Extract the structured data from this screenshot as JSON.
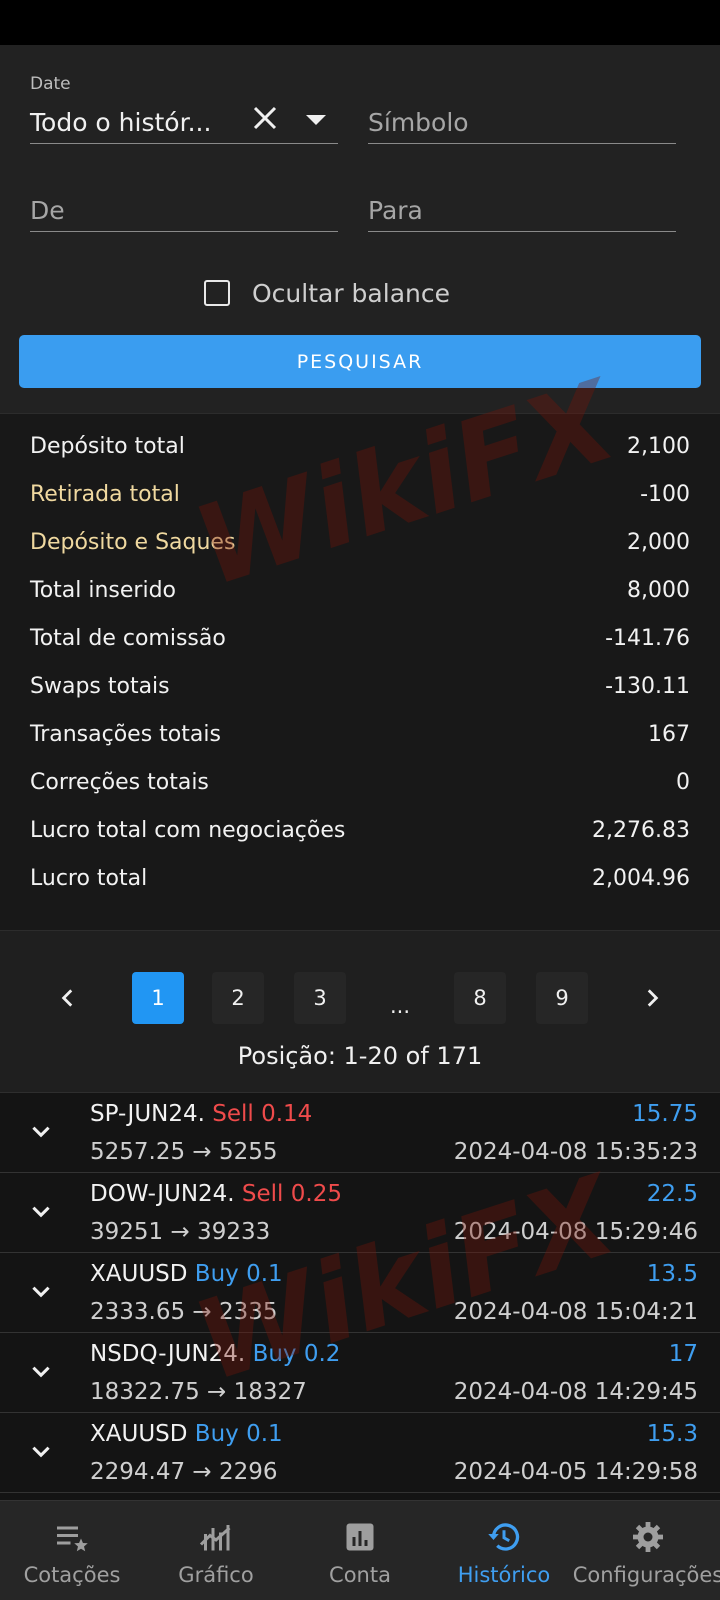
{
  "filters": {
    "date_label": "Date",
    "date_value": "Todo o histór...",
    "symbol_placeholder": "Símbolo",
    "from_placeholder": "De",
    "to_placeholder": "Para",
    "hide_balance_label": "Ocultar balance",
    "hide_balance_checked": false,
    "search_button": "PESQUISAR"
  },
  "summary": [
    {
      "label": "Depósito total",
      "value": "2,100"
    },
    {
      "label": "Retirada total",
      "value": "-100"
    },
    {
      "label": "Depósito e Saques",
      "value": "2,000"
    },
    {
      "label": "Total inserido",
      "value": "8,000"
    },
    {
      "label": "Total de comissão",
      "value": "-141.76"
    },
    {
      "label": "Swaps totais",
      "value": "-130.11"
    },
    {
      "label": "Transações totais",
      "value": "167"
    },
    {
      "label": "Correções totais",
      "value": "0"
    },
    {
      "label": "Lucro total com negociações",
      "value": "2,276.83"
    },
    {
      "label": "Lucro total",
      "value": "2,004.96"
    }
  ],
  "pagination": {
    "prev": "‹",
    "pages": [
      "1",
      "2",
      "3",
      "...",
      "8",
      "9"
    ],
    "active_page": "1",
    "next": "›",
    "position_text": "Posição: 1-20 of 171"
  },
  "deals": [
    {
      "symbol": "SP-JUN24.",
      "side": "Sell 0.14",
      "prices": "5257.25 → 5255",
      "profit": "15.75",
      "time": "2024-04-08 15:35:23"
    },
    {
      "symbol": "DOW-JUN24.",
      "side": "Sell 0.25",
      "prices": "39251 → 39233",
      "profit": "22.5",
      "time": "2024-04-08 15:29:46"
    },
    {
      "symbol": "XAUUSD",
      "side": "Buy 0.1",
      "prices": "2333.65 → 2335",
      "profit": "13.5",
      "time": "2024-04-08 15:04:21"
    },
    {
      "symbol": "NSDQ-JUN24.",
      "side": "Buy 0.2",
      "prices": "18322.75 → 18327",
      "profit": "17",
      "time": "2024-04-08 14:29:45"
    },
    {
      "symbol": "XAUUSD",
      "side": "Buy 0.1",
      "prices": "2294.47 → 2296",
      "profit": "15.3",
      "time": "2024-04-05 14:29:58"
    }
  ],
  "nav": {
    "quotes": "Cotações",
    "chart": "Gráfico",
    "account": "Conta",
    "history": "Histórico",
    "settings": "Configurações"
  },
  "watermark": "WikiFX",
  "colors": {
    "accent": "#2196f3",
    "sell": "#ef4b4b",
    "buy": "#3f9ef0"
  }
}
